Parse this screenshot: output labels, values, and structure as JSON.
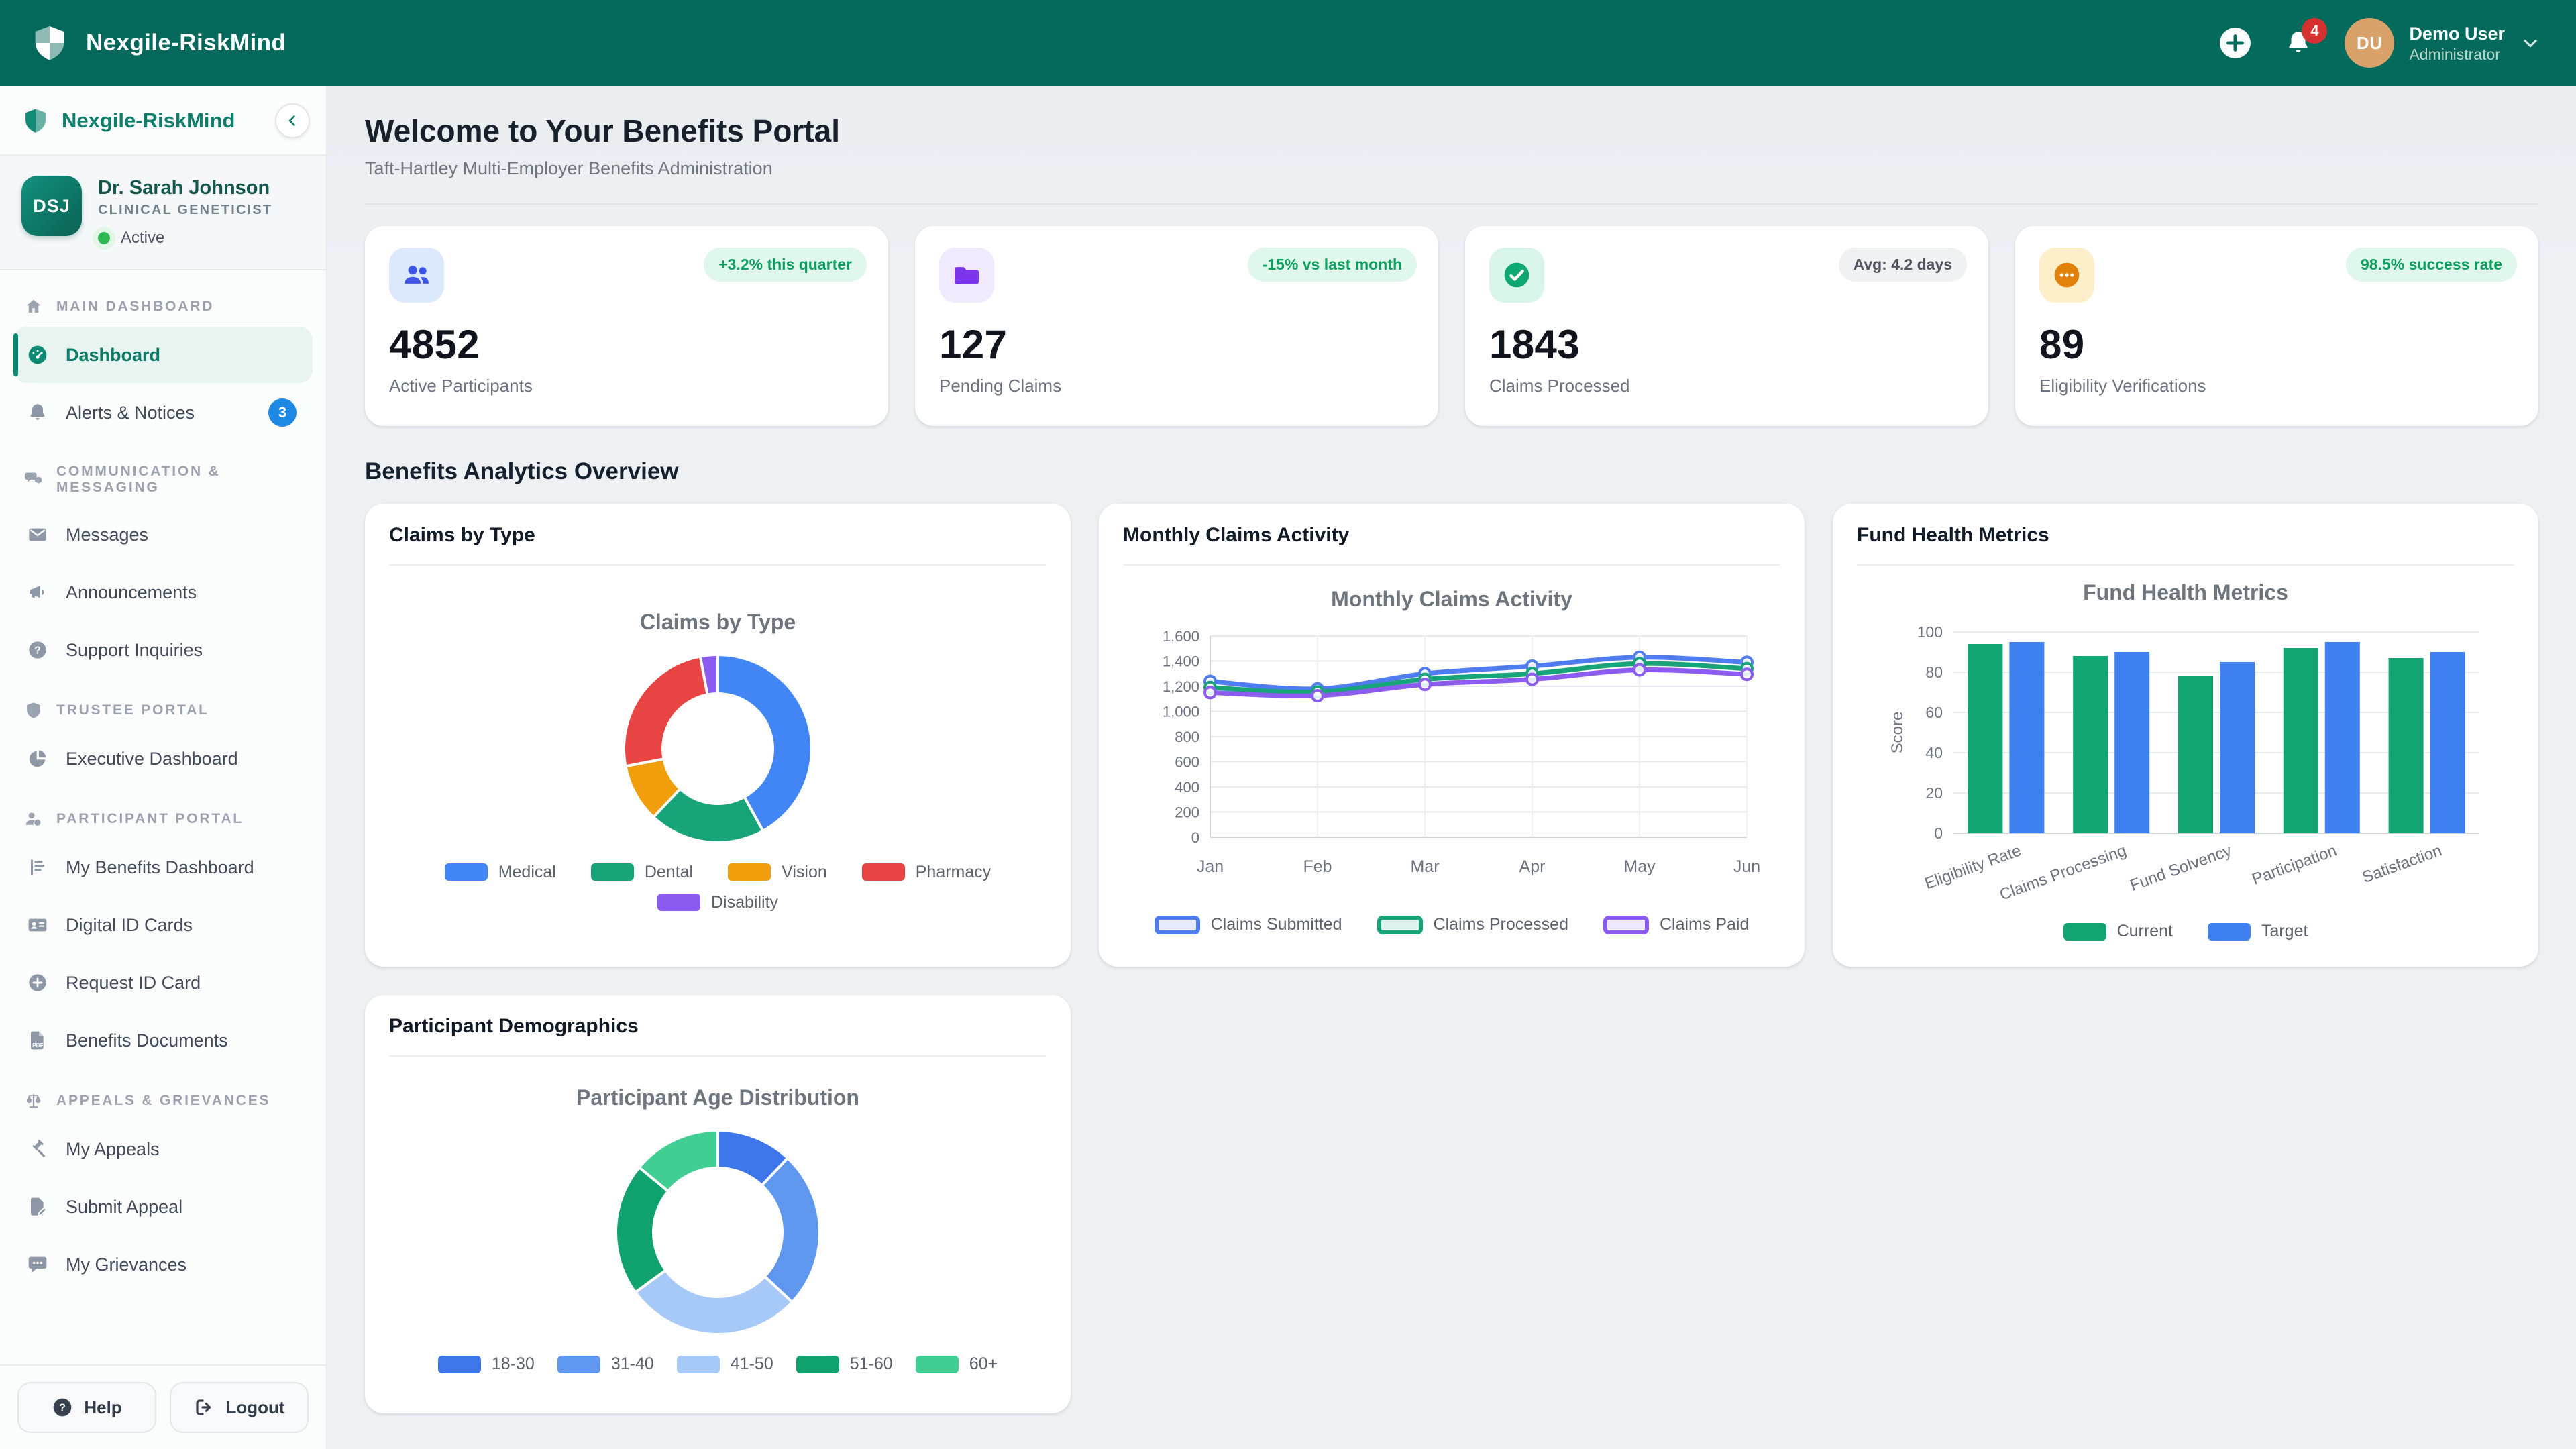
{
  "header": {
    "brand": "Nexgile-RiskMind",
    "notifications": "4",
    "user": {
      "initials": "DU",
      "name": "Demo User",
      "role": "Administrator"
    }
  },
  "sidebar": {
    "brand": "Nexgile-RiskMind",
    "profile": {
      "initials": "DSJ",
      "name": "Dr. Sarah Johnson",
      "title": "CLINICAL GENETICIST",
      "status": "Active"
    },
    "sections": [
      {
        "label": "MAIN DASHBOARD",
        "icon": "home",
        "items": [
          {
            "label": "Dashboard",
            "icon": "gauge",
            "active": true
          },
          {
            "label": "Alerts & Notices",
            "icon": "bell",
            "badge": "3"
          }
        ]
      },
      {
        "label": "COMMUNICATION & MESSAGING",
        "icon": "chat",
        "items": [
          {
            "label": "Messages",
            "icon": "envelope"
          },
          {
            "label": "Announcements",
            "icon": "megaphone"
          },
          {
            "label": "Support Inquiries",
            "icon": "question"
          }
        ]
      },
      {
        "label": "TRUSTEE PORTAL",
        "icon": "shield",
        "items": [
          {
            "label": "Executive Dashboard",
            "icon": "pie"
          }
        ]
      },
      {
        "label": "PARTICIPANT PORTAL",
        "icon": "person",
        "items": [
          {
            "label": "My Benefits Dashboard",
            "icon": "list"
          },
          {
            "label": "Digital ID Cards",
            "icon": "idcard"
          },
          {
            "label": "Request ID Card",
            "icon": "pluscircle"
          },
          {
            "label": "Benefits Documents",
            "icon": "pdf"
          }
        ]
      },
      {
        "label": "APPEALS & GRIEVANCES",
        "icon": "scales",
        "items": [
          {
            "label": "My Appeals",
            "icon": "gavel"
          },
          {
            "label": "Submit Appeal",
            "icon": "filepen"
          },
          {
            "label": "My Grievances",
            "icon": "comment"
          }
        ]
      }
    ],
    "footer": {
      "help": "Help",
      "logout": "Logout"
    }
  },
  "main": {
    "title": "Welcome to Your Benefits Portal",
    "subtitle": "Taft-Hartley Multi-Employer Benefits Administration",
    "section_title": "Benefits Analytics Overview",
    "stats": [
      {
        "value": "4852",
        "label": "Active Participants",
        "badge": "+3.2% this quarter",
        "badge_type": "green",
        "icon": "people",
        "icon_color": "#3f55e8",
        "icon_bg": "#dce8fb"
      },
      {
        "value": "127",
        "label": "Pending Claims",
        "badge": "-15% vs last month",
        "badge_type": "green",
        "icon": "folder",
        "icon_color": "#7c35ec",
        "icon_bg": "#f1e9fd"
      },
      {
        "value": "1843",
        "label": "Claims Processed",
        "badge": "Avg: 4.2 days",
        "badge_type": "gray",
        "icon": "check",
        "icon_color": "#0fa86f",
        "icon_bg": "#d9f4e8"
      },
      {
        "value": "89",
        "label": "Eligibility Verifications",
        "badge": "98.5% success rate",
        "badge_type": "green",
        "icon": "dots",
        "icon_color": "#e1810c",
        "icon_bg": "#fdefc9"
      }
    ],
    "cards": [
      {
        "title": "Claims by Type"
      },
      {
        "title": "Monthly Claims Activity"
      },
      {
        "title": "Fund Health Metrics"
      },
      {
        "title": "Participant Demographics"
      }
    ]
  },
  "chart_data": [
    {
      "type": "pie",
      "title": "Claims by Type",
      "labels": [
        "Medical",
        "Dental",
        "Vision",
        "Pharmacy",
        "Disability"
      ],
      "values": [
        42,
        20,
        10,
        25,
        3
      ],
      "colors": [
        "#4285f4",
        "#17a478",
        "#f09e0b",
        "#e94444",
        "#8c5cf0"
      ],
      "donut": true,
      "legend_position": "bottom"
    },
    {
      "type": "line",
      "title": "Monthly Claims Activity",
      "x": [
        "Jan",
        "Feb",
        "Mar",
        "Apr",
        "May",
        "Jun"
      ],
      "series": [
        {
          "name": "Claims Submitted",
          "values": [
            1240,
            1180,
            1300,
            1360,
            1430,
            1390
          ],
          "color": "#4f7cf0"
        },
        {
          "name": "Claims Processed",
          "values": [
            1190,
            1155,
            1255,
            1300,
            1380,
            1340
          ],
          "color": "#17a478"
        },
        {
          "name": "Claims Paid",
          "values": [
            1150,
            1125,
            1215,
            1255,
            1330,
            1295
          ],
          "color": "#8c5cf0"
        }
      ],
      "ylim": [
        0,
        1600
      ],
      "ystep": 200,
      "grid": true,
      "legend_position": "bottom"
    },
    {
      "type": "bar",
      "title": "Fund Health Metrics",
      "categories": [
        "Eligibility Rate",
        "Claims Processing",
        "Fund Solvency",
        "Participation",
        "Satisfaction"
      ],
      "series": [
        {
          "name": "Current",
          "values": [
            94,
            88,
            78,
            92,
            87
          ],
          "color": "#13a571"
        },
        {
          "name": "Target",
          "values": [
            95,
            90,
            85,
            95,
            90
          ],
          "color": "#3f80f1"
        }
      ],
      "ylabel": "Score",
      "ylim": [
        0,
        100
      ],
      "ystep": 20,
      "grid": true,
      "legend_position": "bottom"
    },
    {
      "type": "pie",
      "title": "Participant Age Distribution",
      "labels": [
        "18-30",
        "31-40",
        "41-50",
        "51-60",
        "60+"
      ],
      "values": [
        12,
        25,
        28,
        21,
        14
      ],
      "colors": [
        "#3d76e8",
        "#5f97ef",
        "#a7c9f7",
        "#10a36d",
        "#41ce92"
      ],
      "donut": true,
      "legend_position": "bottom"
    }
  ]
}
